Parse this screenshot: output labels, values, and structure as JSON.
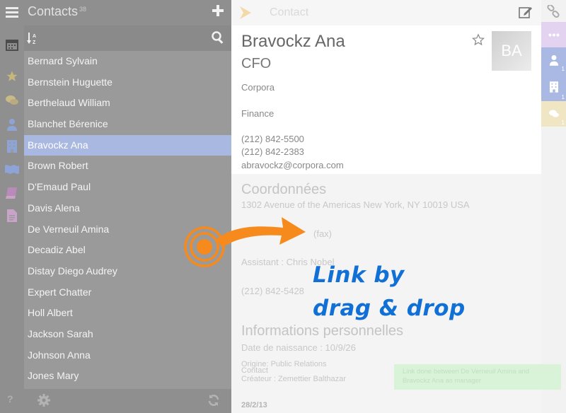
{
  "list": {
    "title": "Contacts",
    "count": "38",
    "contacts": [
      "Bernard Sylvain",
      "Bernstein Huguette",
      "Berthelaud William",
      "Blanchet Bérenice",
      "Bravockz Ana",
      "Brown Robert",
      "D'Emaud Paul",
      "Davis Alena",
      "De Verneuil Amina",
      "Decadiz Abel",
      "Distay Diego Audrey",
      "Expert Chatter",
      "Holl Albert",
      "Jackson Sarah",
      "Johnson Anna",
      "Jones Mary"
    ],
    "selected_index": 4
  },
  "rail": {
    "help_label": "?",
    "icons": [
      "menu-icon",
      "calendar-icon",
      "star-icon",
      "chat-icon",
      "person-icon",
      "building-icon",
      "flag-icon",
      "book-icon",
      "document-icon"
    ]
  },
  "detail": {
    "header_title": "Contact",
    "name": "Bravockz Ana",
    "job_title": "CFO",
    "photo_initials": "BA",
    "company": "Corpora",
    "department": "Finance",
    "phone": "(212) 842-5500",
    "phone2": "(212) 842-2383",
    "email": "abravockz@corpora.com",
    "coord_heading": "Coordonnées",
    "address": "1302 Avenue of the Americas New York, NY 10019 USA",
    "fax_label": "(fax)",
    "assistant": "Assistant : Chris Nobel",
    "assistant_phone": "(212) 842-5428",
    "perso_heading": "Informations personnelles",
    "birthdate": "Date de naissance : 10/9/26",
    "origin": "Origine: Public Relations",
    "contact_label": "Contact",
    "creator": "Créateur : Zemettier Balthazar",
    "date_fragment": "28/2/13"
  },
  "right_rail": {
    "counts": [
      "1",
      "1",
      "1"
    ],
    "colors": {
      "more": "#e3d3f1",
      "person": "#a9b9e3",
      "building": "#a9b9e3",
      "chat": "#f1e6c4"
    }
  },
  "toast": {
    "text": "Link done between De Verneuil Amina and Bravockz Ana as manager"
  },
  "overlay": {
    "line1": "Link by",
    "line2": "drag & drop"
  },
  "colors": {
    "accent_blue": "#1170d6",
    "arrow_orange": "#f78a1d",
    "selected_row": "#a9b8e0"
  }
}
